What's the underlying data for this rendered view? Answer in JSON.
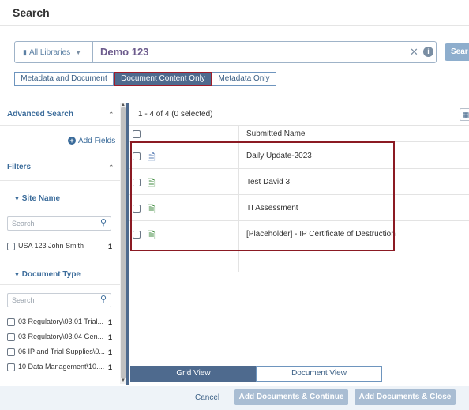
{
  "page": {
    "title": "Search"
  },
  "search": {
    "library_label": "All Libraries",
    "query": "Demo 123",
    "button_label": "Sear"
  },
  "modes": [
    {
      "label": "Metadata and Document",
      "active": false
    },
    {
      "label": "Document Content Only",
      "active": true
    },
    {
      "label": "Metadata Only",
      "active": false
    }
  ],
  "sidebar": {
    "advanced_search": "Advanced Search",
    "add_fields": "Add Fields",
    "filters": "Filters",
    "site_name": {
      "title": "Site Name",
      "search_placeholder": "Search",
      "items": [
        {
          "label": "USA 123 John Smith",
          "count": "1"
        }
      ]
    },
    "document_type": {
      "title": "Document Type",
      "search_placeholder": "Search",
      "items": [
        {
          "label": "03 Regulatory\\03.01 Trial...",
          "count": "1"
        },
        {
          "label": "03 Regulatory\\03.04 Gen...",
          "count": "1"
        },
        {
          "label": "06 IP and Trial Supplies\\0...",
          "count": "1"
        },
        {
          "label": "10 Data Management\\10....",
          "count": "1"
        }
      ]
    }
  },
  "results": {
    "count_text": "1 - 4 of 4 (0 selected)",
    "column_header": "Submitted Name",
    "rows": [
      {
        "name": "Daily Update-2023",
        "icon": "word-doc-icon",
        "color": "#5b7fb6"
      },
      {
        "name": "Test David 3",
        "icon": "excel-icon",
        "color": "#3c8a3c"
      },
      {
        "name": "TI Assessment",
        "icon": "excel-icon",
        "color": "#3c8a3c"
      },
      {
        "name": "[Placeholder] - IP Certificate of Destruction",
        "icon": "excel-icon",
        "color": "#3c8a3c"
      }
    ]
  },
  "views": {
    "grid": "Grid View",
    "document": "Document View"
  },
  "footer": {
    "cancel": "Cancel",
    "add_continue": "Add Documents & Continue",
    "add_close": "Add Documents & Close"
  },
  "colors": {
    "accent": "#4e6a8e",
    "highlight_border": "#8b1a23"
  }
}
